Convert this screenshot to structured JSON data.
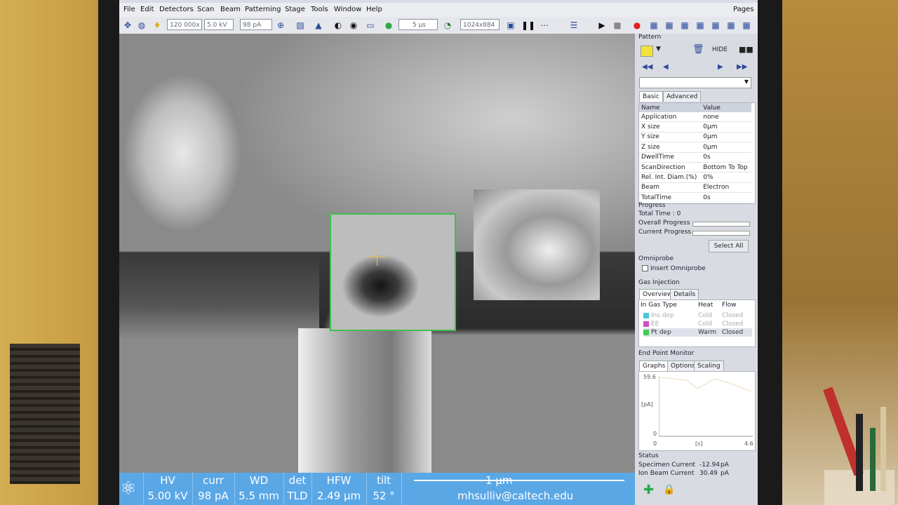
{
  "menu": [
    "File",
    "Edit",
    "Detectors",
    "Scan",
    "Beam",
    "Patterning",
    "Stage",
    "Tools",
    "Window",
    "Help"
  ],
  "menu_right": "Pages",
  "toolbar": {
    "magnification": "120 000x",
    "voltage": "5.0 kV",
    "current": "98 pA",
    "dwell": "5 µs",
    "resolution": "1024x884"
  },
  "status": {
    "cols": [
      {
        "label": "HV",
        "value": "5.00 kV"
      },
      {
        "label": "curr",
        "value": "98 pA"
      },
      {
        "label": "WD",
        "value": "5.5 mm"
      },
      {
        "label": "det",
        "value": "TLD"
      },
      {
        "label": "HFW",
        "value": "2.49 µm"
      },
      {
        "label": "tilt",
        "value": "52 °"
      }
    ],
    "scale": "1 µm",
    "user": "mhsulliv@caltech.edu"
  },
  "panel": {
    "pattern_title": "Pattern",
    "hide_label": "HIDE",
    "tabs": [
      "Basic",
      "Advanced"
    ],
    "table_headers": {
      "name": "Name",
      "value": "Value"
    },
    "rows": [
      {
        "name": "Application",
        "value": "none"
      },
      {
        "name": "X size",
        "value": "0µm"
      },
      {
        "name": "Y size",
        "value": "0µm"
      },
      {
        "name": "Z size",
        "value": "0µm"
      },
      {
        "name": "DwellTime",
        "value": "0s"
      },
      {
        "name": "ScanDirection",
        "value": "Bottom To Top"
      },
      {
        "name": "Rel. Int. Diam.(%)",
        "value": "0%"
      },
      {
        "name": "Beam",
        "value": "Electron"
      },
      {
        "name": "TotalTime",
        "value": "0s"
      }
    ],
    "progress_title": "Progress",
    "total_time": "Total Time : 0",
    "overall_progress": "Overall Progress",
    "current_progress": "Current Progress",
    "select_all": "Select All",
    "omniprobe_title": "Omniprobe",
    "insert_omniprobe": "Insert Omniprobe",
    "gas_title": "Gas Injection",
    "gas_tabs": [
      "Overview",
      "Details"
    ],
    "gas_headers": {
      "type": "In Gas Type",
      "heat": "Heat",
      "flow": "Flow"
    },
    "gas_rows": [
      {
        "type": "Ins dep",
        "heat": "Cold",
        "flow": "Closed",
        "color": "#49c8d6"
      },
      {
        "type": "EE",
        "heat": "Cold",
        "flow": "Closed",
        "color": "#d04fc4"
      },
      {
        "type": "Pt dep",
        "heat": "Warm",
        "flow": "Closed",
        "color": "#3fcf4f"
      }
    ],
    "epm_title": "End Point Monitor",
    "epm_tabs": [
      "Graphs",
      "Options",
      "Scaling"
    ],
    "graph": {
      "ymax": "59.6",
      "ylabel": "[pA]",
      "ymin": "0",
      "xmin": "0",
      "xlabel": "[s]",
      "xmax": "4.6"
    },
    "status_title": "Status",
    "specimen_current_label": "Specimen Current",
    "specimen_current_value": "-12.94",
    "specimen_current_unit": "pA",
    "ion_current_label": "Ion Beam Current",
    "ion_current_value": "30.49",
    "ion_current_unit": "pA"
  }
}
